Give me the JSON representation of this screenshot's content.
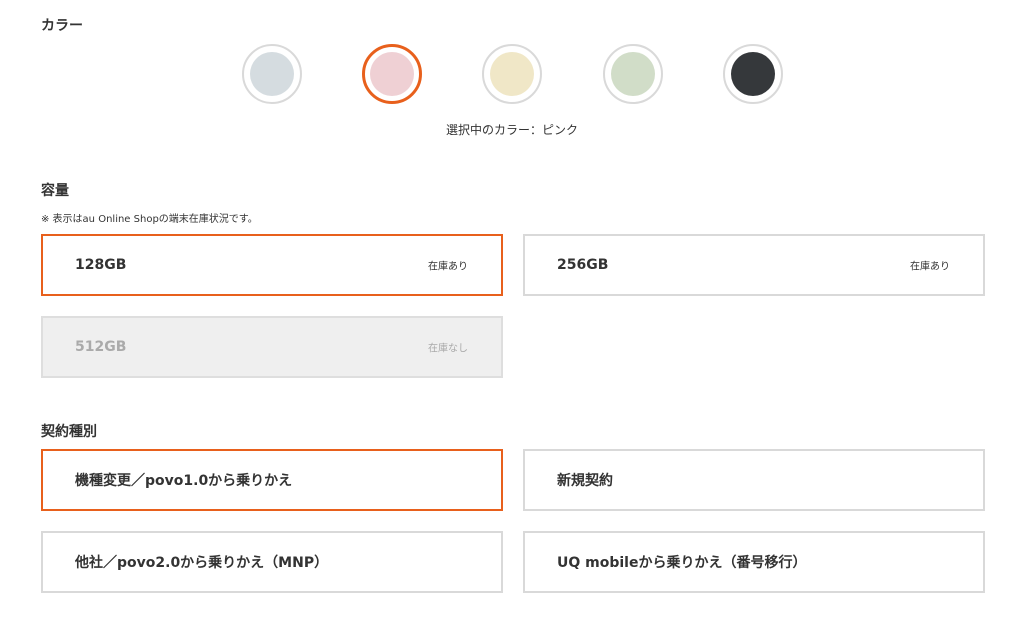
{
  "color": {
    "title": "カラー",
    "swatches": [
      {
        "name": "gray",
        "hex": "#d5dce0"
      },
      {
        "name": "pink",
        "hex": "#efd0d4"
      },
      {
        "name": "cream",
        "hex": "#f0e7c7"
      },
      {
        "name": "sage",
        "hex": "#d1ddc8"
      },
      {
        "name": "black",
        "hex": "#35383b"
      }
    ],
    "selected_index": 1,
    "selected_label": "選択中のカラー：ピンク"
  },
  "capacity": {
    "title": "容量",
    "note": "※ 表示はau Online Shopの端末在庫状況です。",
    "options": [
      {
        "label": "128GB",
        "stock": "在庫あり",
        "selected": true,
        "disabled": false
      },
      {
        "label": "256GB",
        "stock": "在庫あり",
        "selected": false,
        "disabled": false
      },
      {
        "label": "512GB",
        "stock": "在庫なし",
        "selected": false,
        "disabled": true
      }
    ]
  },
  "contract": {
    "title": "契約種別",
    "options": [
      {
        "label": "機種変更／povo1.0から乗りかえ",
        "selected": true
      },
      {
        "label": "新規契約",
        "selected": false
      },
      {
        "label": "他社／povo2.0から乗りかえ（MNP）",
        "selected": false
      },
      {
        "label": "UQ mobileから乗りかえ（番号移行）",
        "selected": false
      }
    ]
  },
  "accent_color": "#e8601c"
}
